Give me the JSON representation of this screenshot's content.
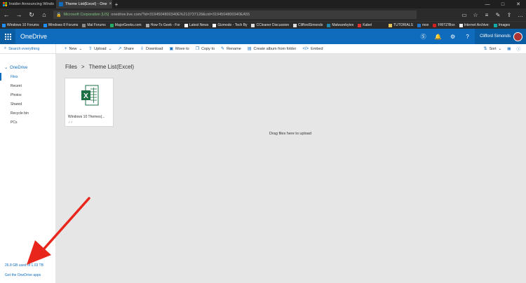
{
  "browser": {
    "tabs": [
      {
        "title": "Insider Announcing Windo",
        "active": false,
        "favicon": "windows-icon"
      },
      {
        "title": "Theme List(Excel) - One",
        "active": true,
        "favicon": "onedrive-icon"
      }
    ],
    "url_org": "Microsoft Corporation [US]",
    "url": "onedrive.live.com/?id=3194504800340E%213737128&cid=3194504800340EA55",
    "favorites": [
      "Windows 10 Forums",
      "Windows 8 Forums",
      "Mal Forums",
      "MajorGeeks.com",
      "How-To Geek - For",
      "Latest News",
      "Gizmodo - Tech By",
      "CCleaner Discussion",
      "CliffordSimonds",
      "Malwarebytes",
      "Kabel",
      "TUTORIALS",
      "msn",
      "FRITZ!Box",
      "Internet Archive:",
      "Images"
    ]
  },
  "onedrive": {
    "brand": "OneDrive",
    "user_name": "Clifford Simonds",
    "search_placeholder": "Search everything",
    "commands": {
      "new": "New",
      "upload": "Upload",
      "share": "Share",
      "download": "Download",
      "move_to": "Move to",
      "copy_to": "Copy to",
      "rename": "Rename",
      "create_album": "Create album from folder",
      "embed": "Embed",
      "sort": "Sort"
    },
    "nav": {
      "root": "OneDrive",
      "items": [
        "Files",
        "Recent",
        "Photos",
        "Shared",
        "Recycle bin",
        "PCs"
      ],
      "active_index": 0
    },
    "storage": "26.8 GB used of 1.03 TB",
    "get_apps": "Get the OneDrive apps",
    "breadcrumb": {
      "root": "Files",
      "sep": ">",
      "current": "Theme List(Excel)"
    },
    "file": {
      "name": "Windows 10 Themes(...",
      "shared": "♂♂"
    },
    "drop_hint": "Drag files here to upload"
  },
  "colors": {
    "accent": "#0f6cbd",
    "annotation": "#e8261c",
    "excel": "#1e7145"
  }
}
